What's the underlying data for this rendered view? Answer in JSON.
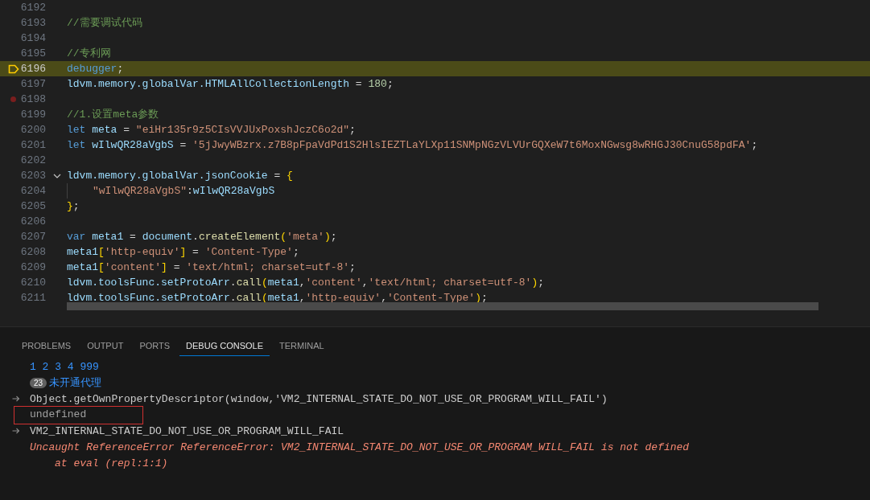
{
  "editor": {
    "lines": [
      {
        "number": "6192",
        "current": false,
        "breakpoint": false
      },
      {
        "number": "6193",
        "current": false,
        "breakpoint": false,
        "tokens": [
          {
            "kind": "comment",
            "text": "//需要调试代码"
          }
        ]
      },
      {
        "number": "6194",
        "current": false,
        "breakpoint": false
      },
      {
        "number": "6195",
        "current": false,
        "breakpoint": false,
        "tokens": [
          {
            "kind": "comment",
            "text": "//专利网"
          }
        ]
      },
      {
        "number": "6196",
        "current": true,
        "breakpoint": false,
        "tokens": [
          {
            "kind": "keyword",
            "text": "debugger"
          },
          {
            "kind": "plain",
            "text": ";"
          }
        ]
      },
      {
        "number": "6197",
        "current": false,
        "breakpoint": false,
        "tokens": [
          {
            "kind": "variable",
            "text": "ldvm.memory.globalVar.HTMLAllCollectionLength"
          },
          {
            "kind": "plain",
            "text": " = "
          },
          {
            "kind": "number",
            "text": "180"
          },
          {
            "kind": "plain",
            "text": ";"
          }
        ]
      },
      {
        "number": "6198",
        "current": false,
        "breakpoint": true
      },
      {
        "number": "6199",
        "current": false,
        "breakpoint": false,
        "tokens": [
          {
            "kind": "comment",
            "text": "//1.设置meta参数"
          }
        ]
      },
      {
        "number": "6200",
        "current": false,
        "breakpoint": false,
        "tokens": [
          {
            "kind": "keyword",
            "text": "let "
          },
          {
            "kind": "variable",
            "text": "meta"
          },
          {
            "kind": "plain",
            "text": " = "
          },
          {
            "kind": "string",
            "text": "\"eiHr135r9z5CIsVVJUxPoxshJczC6o2d\""
          },
          {
            "kind": "plain",
            "text": ";"
          }
        ]
      },
      {
        "number": "6201",
        "current": false,
        "breakpoint": false,
        "tokens": [
          {
            "kind": "keyword",
            "text": "let "
          },
          {
            "kind": "variable",
            "text": "wIlwQR28aVgbS"
          },
          {
            "kind": "plain",
            "text": " = "
          },
          {
            "kind": "string",
            "text": "'5jJwyWBzrx.z7B8pFpaVdPd1S2HlsIEZTLaYLXp11SNMpNGzVLVUrGQXeW7t6MoxNGwsg8wRHGJ30CnuG58pdFA'"
          },
          {
            "kind": "plain",
            "text": ";"
          }
        ]
      },
      {
        "number": "6202",
        "current": false,
        "breakpoint": false
      },
      {
        "number": "6203",
        "current": false,
        "breakpoint": false,
        "expanded": true,
        "tokens": [
          {
            "kind": "variable",
            "text": "ldvm.memory.globalVar.jsonCookie"
          },
          {
            "kind": "plain",
            "text": " = "
          },
          {
            "kind": "bracket",
            "text": "{"
          }
        ],
        "children": [
          {
            "number": "6204",
            "current": false,
            "breakpoint": false,
            "tokens": [
              {
                "kind": "string",
                "text": "\"wIlwQR28aVgbS\""
              },
              {
                "kind": "plain",
                "text": ":"
              },
              {
                "kind": "variable",
                "text": "wIlwQR28aVgbS"
              }
            ]
          }
        ]
      },
      {
        "number": "6205",
        "current": false,
        "breakpoint": false,
        "tokens": [
          {
            "kind": "bracket",
            "text": "}"
          },
          {
            "kind": "plain",
            "text": ";"
          }
        ]
      },
      {
        "number": "6206",
        "current": false,
        "breakpoint": false
      },
      {
        "number": "6207",
        "current": false,
        "breakpoint": false,
        "tokens": [
          {
            "kind": "keyword",
            "text": "var "
          },
          {
            "kind": "variable",
            "text": "meta1"
          },
          {
            "kind": "plain",
            "text": " = "
          },
          {
            "kind": "variable",
            "text": "document"
          },
          {
            "kind": "plain",
            "text": "."
          },
          {
            "kind": "function",
            "text": "createElement"
          },
          {
            "kind": "bracket",
            "text": "("
          },
          {
            "kind": "string",
            "text": "'meta'"
          },
          {
            "kind": "bracket",
            "text": ")"
          },
          {
            "kind": "plain",
            "text": ";"
          }
        ]
      },
      {
        "number": "6208",
        "current": false,
        "breakpoint": false,
        "tokens": [
          {
            "kind": "variable",
            "text": "meta1"
          },
          {
            "kind": "bracket",
            "text": "["
          },
          {
            "kind": "string",
            "text": "'http-equiv'"
          },
          {
            "kind": "bracket",
            "text": "]"
          },
          {
            "kind": "plain",
            "text": " = "
          },
          {
            "kind": "string",
            "text": "'Content-Type'"
          },
          {
            "kind": "plain",
            "text": ";"
          }
        ]
      },
      {
        "number": "6209",
        "current": false,
        "breakpoint": false,
        "tokens": [
          {
            "kind": "variable",
            "text": "meta1"
          },
          {
            "kind": "bracket",
            "text": "["
          },
          {
            "kind": "string",
            "text": "'content'"
          },
          {
            "kind": "bracket",
            "text": "]"
          },
          {
            "kind": "plain",
            "text": " = "
          },
          {
            "kind": "string",
            "text": "'text/html; charset=utf-8'"
          },
          {
            "kind": "plain",
            "text": ";"
          }
        ]
      },
      {
        "number": "6210",
        "current": false,
        "breakpoint": false,
        "tokens": [
          {
            "kind": "variable",
            "text": "ldvm.toolsFunc.setProtoArr"
          },
          {
            "kind": "plain",
            "text": "."
          },
          {
            "kind": "function",
            "text": "call"
          },
          {
            "kind": "bracket",
            "text": "("
          },
          {
            "kind": "variable",
            "text": "meta1"
          },
          {
            "kind": "plain",
            "text": ","
          },
          {
            "kind": "string",
            "text": "'content'"
          },
          {
            "kind": "plain",
            "text": ","
          },
          {
            "kind": "string",
            "text": "'text/html; charset=utf-8'"
          },
          {
            "kind": "bracket",
            "text": ")"
          },
          {
            "kind": "plain",
            "text": ";"
          }
        ]
      },
      {
        "number": "6211",
        "current": false,
        "breakpoint": false,
        "tokens": [
          {
            "kind": "variable",
            "text": "ldvm.toolsFunc.setProtoArr"
          },
          {
            "kind": "plain",
            "text": "."
          },
          {
            "kind": "function",
            "text": "call"
          },
          {
            "kind": "bracket",
            "text": "("
          },
          {
            "kind": "variable",
            "text": "meta1"
          },
          {
            "kind": "plain",
            "text": ","
          },
          {
            "kind": "string",
            "text": "'http-equiv'"
          },
          {
            "kind": "plain",
            "text": ","
          },
          {
            "kind": "string",
            "text": "'Content-Type'"
          },
          {
            "kind": "bracket",
            "text": ")"
          },
          {
            "kind": "plain",
            "text": ";"
          }
        ]
      }
    ]
  },
  "panel": {
    "tabs": [
      {
        "label": "PROBLEMS",
        "selected": false
      },
      {
        "label": "OUTPUT",
        "selected": false
      },
      {
        "label": "PORTS",
        "selected": false
      },
      {
        "label": "DEBUG CONSOLE",
        "selected": true
      },
      {
        "label": "TERMINAL",
        "selected": false
      }
    ],
    "console": [
      {
        "kind": "log",
        "text": "1 2 3 4 999",
        "framed": false
      },
      {
        "kind": "repeat",
        "count": "23",
        "text": "未开通代理",
        "framed": false
      },
      {
        "kind": "input",
        "text": "Object.getOwnPropertyDescriptor(window,'VM2_INTERNAL_STATE_DO_NOT_USE_OR_PROGRAM_WILL_FAIL')",
        "framed": false
      },
      {
        "kind": "result",
        "text": "undefined",
        "framed": true
      },
      {
        "kind": "input",
        "text": "VM2_INTERNAL_STATE_DO_NOT_USE_OR_PROGRAM_WILL_FAIL",
        "framed": false
      },
      {
        "kind": "error",
        "text": "Uncaught ReferenceError ReferenceError: VM2_INTERNAL_STATE_DO_NOT_USE_OR_PROGRAM_WILL_FAIL is not defined",
        "framed": false
      },
      {
        "kind": "stack",
        "text": "at eval (repl:1:1)",
        "framed": false
      }
    ]
  }
}
